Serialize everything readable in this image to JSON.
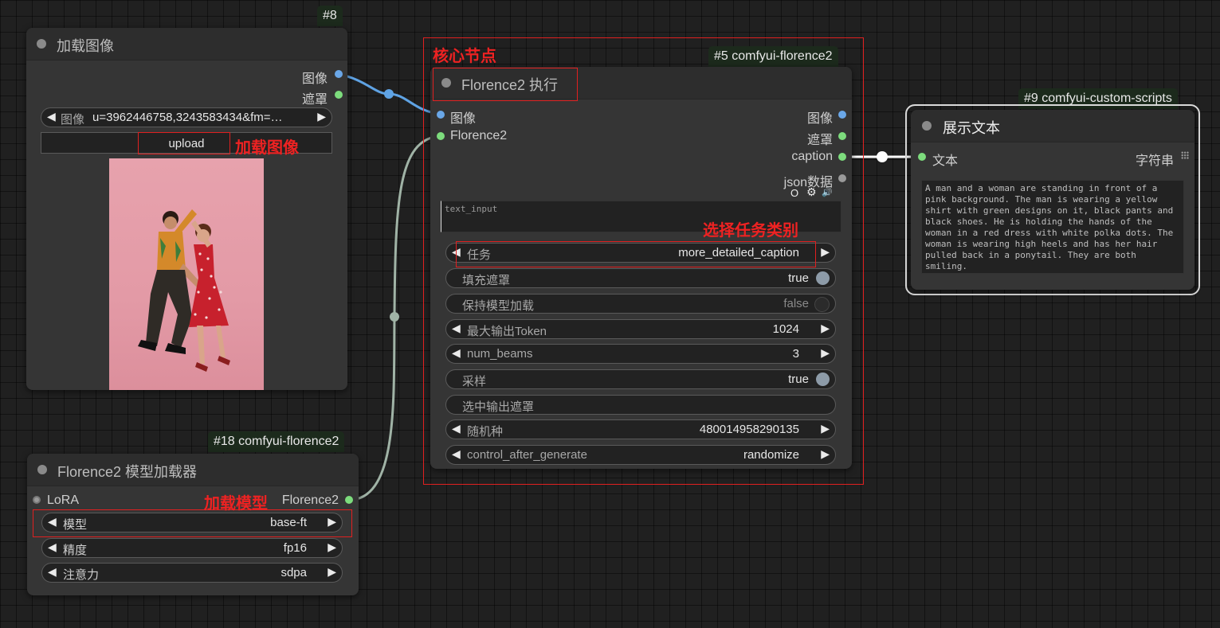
{
  "links": {
    "image_color": "#5fa3e4",
    "model_color": "#a0b3a6",
    "text_color": "#ffffff"
  },
  "load_image_node": {
    "badge": "#8",
    "title": "加载图像",
    "outputs": [
      "图像",
      "遮罩"
    ],
    "image_widget": {
      "label": "图像",
      "value": "u=3962446758,3243583434&fm=…"
    },
    "upload_label": "upload",
    "preview": "photo-of-dancing-couple"
  },
  "model_loader_node": {
    "badge": "#18 comfyui-florence2",
    "title": "Florence2 模型加载器",
    "input": "LoRA",
    "output": "Florence2",
    "widgets": [
      {
        "label": "模型",
        "value": "base-ft"
      },
      {
        "label": "精度",
        "value": "fp16"
      },
      {
        "label": "注意力",
        "value": "sdpa"
      }
    ]
  },
  "florence_node": {
    "badge": "#5 comfyui-florence2",
    "title": "Florence2 执行",
    "inputs": [
      "图像",
      "Florence2"
    ],
    "outputs": [
      "图像",
      "遮罩",
      "caption",
      "json数据"
    ],
    "mini_icons": [
      "O",
      "⚙",
      "🔊"
    ],
    "text_input_placeholder": "text_input",
    "widgets": {
      "task": {
        "label": "任务",
        "value": "more_detailed_caption"
      },
      "fill_mask": {
        "label": "填充遮罩",
        "value": "true"
      },
      "keep_model": {
        "label": "保持模型加载",
        "value": "false"
      },
      "max_tokens": {
        "label": "最大输出Token",
        "value": "1024"
      },
      "num_beams": {
        "label": "num_beams",
        "value": "3"
      },
      "sample": {
        "label": "采样",
        "value": "true"
      },
      "output_mask": {
        "label": "选中输出遮罩"
      },
      "seed": {
        "label": "随机种",
        "value": "480014958290135"
      },
      "control": {
        "label": "control_after_generate",
        "value": "randomize"
      }
    }
  },
  "show_text_node": {
    "badge": "#9 comfyui-custom-scripts",
    "title": "展示文本",
    "input": "文本",
    "output": "字符串",
    "text": "A man and a woman are standing in front of a pink background. The man is wearing a yellow shirt with green designs on it, black pants and black shoes. He is holding the hands of the woman in a red dress with white polka dots. The woman is wearing high heels and has her hair pulled back in a ponytail. They are both smiling."
  },
  "annotations": {
    "core_node": "核心节点",
    "load_image": "加载图像",
    "select_task": "选择任务类别",
    "load_model": "加载模型"
  }
}
